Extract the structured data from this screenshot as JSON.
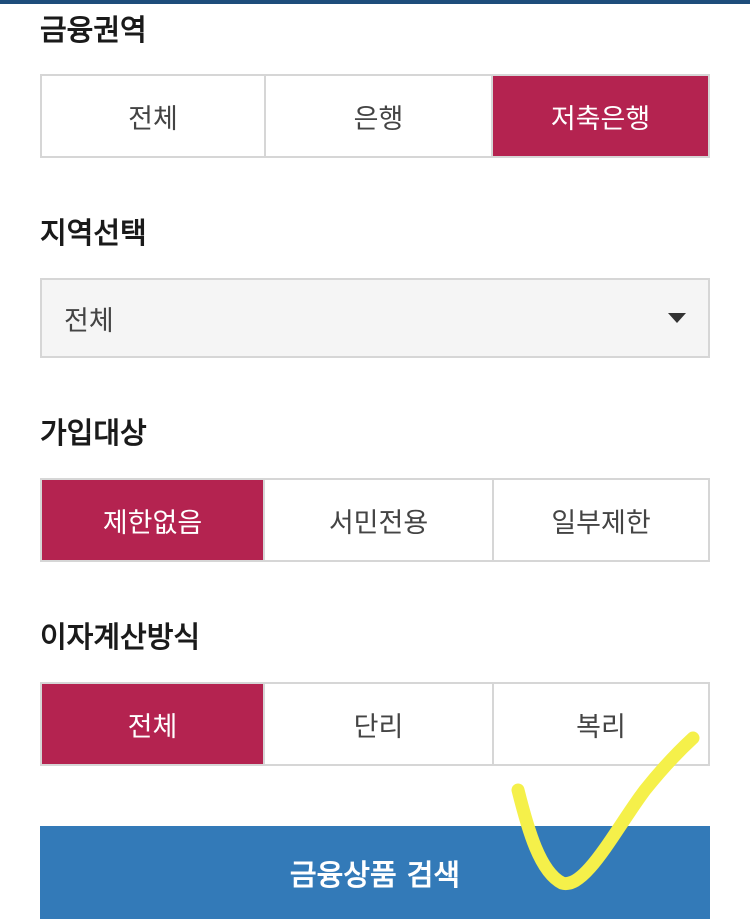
{
  "sections": {
    "financial_area": {
      "title": "금융권역",
      "options": [
        "전체",
        "은행",
        "저축은행"
      ],
      "selected_index": 2
    },
    "region": {
      "title": "지역선택",
      "selected_value": "전체"
    },
    "eligibility": {
      "title": "가입대상",
      "options": [
        "제한없음",
        "서민전용",
        "일부제한"
      ],
      "selected_index": 0
    },
    "interest_method": {
      "title": "이자계산방식",
      "options": [
        "전체",
        "단리",
        "복리"
      ],
      "selected_index": 0
    }
  },
  "search_button_label": "금융상품 검색",
  "icons": {
    "region_dropdown": "caret-down-icon",
    "annotation": "checkmark-annotation-icon"
  },
  "colors": {
    "selected": "#b42350",
    "search_button": "#337ab8",
    "top_bar": "#1e4d7b",
    "annotation": "#f5f04a"
  }
}
